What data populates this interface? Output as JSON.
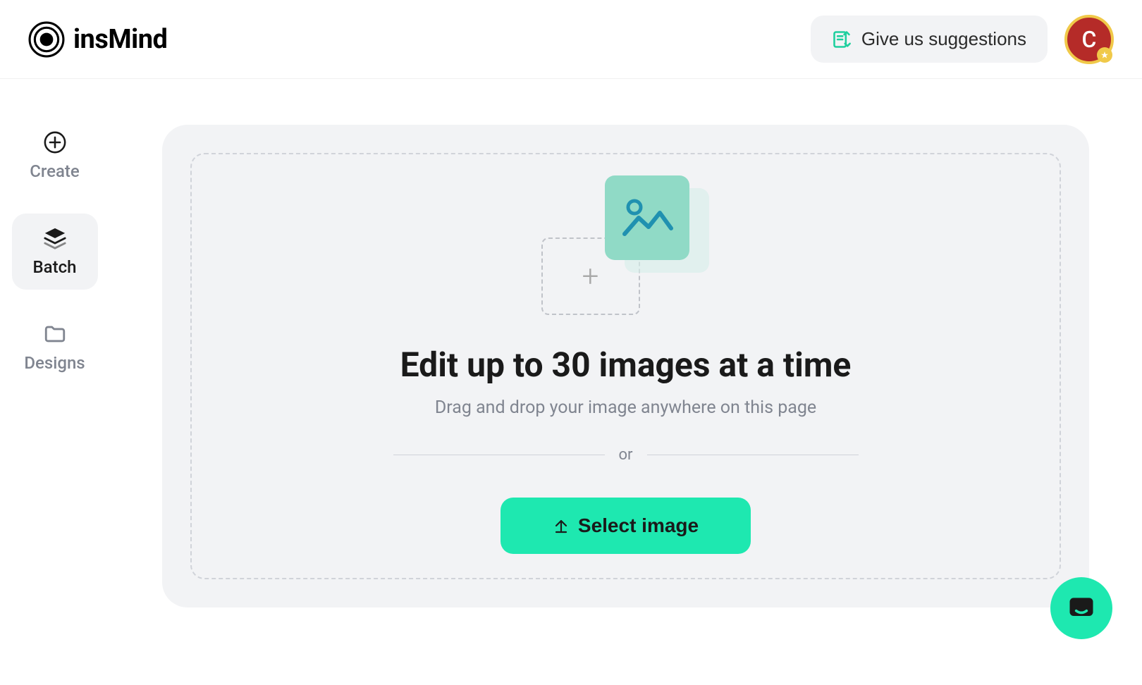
{
  "header": {
    "logo_text": "insMind",
    "suggestions_label": "Give us suggestions",
    "avatar_initial": "C"
  },
  "sidebar": {
    "items": [
      {
        "label": "Create",
        "active": false
      },
      {
        "label": "Batch",
        "active": true
      },
      {
        "label": "Designs",
        "active": false
      }
    ]
  },
  "upload": {
    "title": "Edit up to 30 images at a time",
    "subtitle": "Drag and drop your image anywhere on this page",
    "divider_text": "or",
    "select_label": "Select image"
  }
}
